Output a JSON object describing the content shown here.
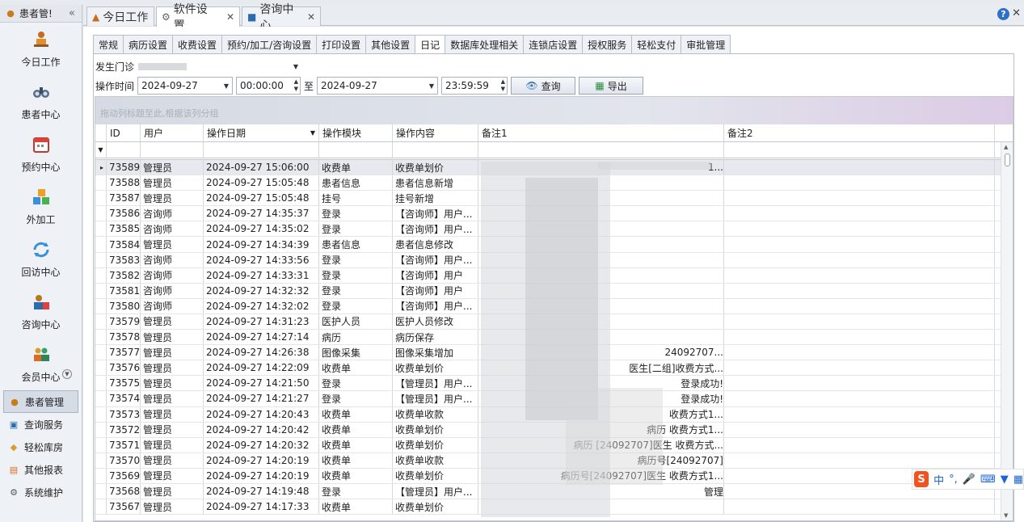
{
  "left_panel": {
    "title": "患者管!",
    "collapse_icon": "double-chevron-left-icon",
    "nav_items": [
      {
        "label": "今日工作",
        "icon": "person-at-desk-icon"
      },
      {
        "label": "患者中心",
        "icon": "binoculars-icon"
      },
      {
        "label": "预约中心",
        "icon": "calendar-icon"
      },
      {
        "label": "外加工",
        "icon": "cubes-icon"
      },
      {
        "label": "回访中心",
        "icon": "refresh-icon"
      },
      {
        "label": "咨询中心",
        "icon": "consultant-icon"
      },
      {
        "label": "会员中心",
        "icon": "members-icon"
      }
    ],
    "groups": [
      {
        "label": "患者管理",
        "active": true
      },
      {
        "label": "查询服务",
        "active": false
      },
      {
        "label": "轻松库房",
        "active": false
      },
      {
        "label": "其他报表",
        "active": false
      },
      {
        "label": "系统维护",
        "active": false
      }
    ]
  },
  "doc_tabs": [
    {
      "label": "今日工作",
      "closable": false,
      "active": false
    },
    {
      "label": "软件设置",
      "closable": true,
      "active": true
    },
    {
      "label": "咨询中心",
      "closable": true,
      "active": false
    }
  ],
  "sub_tabs": [
    {
      "label": "常规",
      "active": false
    },
    {
      "label": "病历设置",
      "active": false
    },
    {
      "label": "收费设置",
      "active": false
    },
    {
      "label": "预约/加工/咨询设置",
      "active": false
    },
    {
      "label": "打印设置",
      "active": false
    },
    {
      "label": "其他设置",
      "active": false
    },
    {
      "label": "日记",
      "active": true
    },
    {
      "label": "数据库处理相关",
      "active": false
    },
    {
      "label": "连锁店设置",
      "active": false
    },
    {
      "label": "授权服务",
      "active": false
    },
    {
      "label": "轻松支付",
      "active": false
    },
    {
      "label": "审批管理",
      "active": false
    }
  ],
  "filters": {
    "clinic_label": "发生门诊",
    "time_label": "操作时间",
    "start_date": "2024-09-27",
    "start_time": "00:00:00",
    "to_label": "至",
    "end_date": "2024-09-27",
    "end_time": "23:59:59",
    "query_button": "查询",
    "export_button": "导出"
  },
  "grid": {
    "group_hint": "拖动列标题至此,根据该列分组",
    "columns": [
      "ID",
      "用户",
      "操作日期",
      "操作模块",
      "操作内容",
      "备注1",
      "备注2"
    ],
    "rows": [
      {
        "id": "73589",
        "user": "管理员",
        "date": "2024-09-27 15:06:00",
        "module": "收费单",
        "content": "收费单划价",
        "note1": "1...",
        "note2": ""
      },
      {
        "id": "73588",
        "user": "管理员",
        "date": "2024-09-27 15:05:48",
        "module": "患者信息",
        "content": "患者信息新增",
        "note1": "",
        "note2": ""
      },
      {
        "id": "73587",
        "user": "管理员",
        "date": "2024-09-27 15:05:48",
        "module": "挂号",
        "content": "挂号新增",
        "note1": "",
        "note2": ""
      },
      {
        "id": "73586",
        "user": "咨询师",
        "date": "2024-09-27 14:35:37",
        "module": "登录",
        "content": "【咨询师】用户...",
        "note1": "",
        "note2": ""
      },
      {
        "id": "73585",
        "user": "咨询师",
        "date": "2024-09-27 14:35:02",
        "module": "登录",
        "content": "【咨询师】用户...",
        "note1": "",
        "note2": ""
      },
      {
        "id": "73584",
        "user": "管理员",
        "date": "2024-09-27 14:34:39",
        "module": "患者信息",
        "content": "患者信息修改",
        "note1": "",
        "note2": ""
      },
      {
        "id": "73583",
        "user": "咨询师",
        "date": "2024-09-27 14:33:56",
        "module": "登录",
        "content": "【咨询师】用户...",
        "note1": "",
        "note2": ""
      },
      {
        "id": "73582",
        "user": "咨询师",
        "date": "2024-09-27 14:33:31",
        "module": "登录",
        "content": "【咨询师】用户",
        "note1": "",
        "note2": ""
      },
      {
        "id": "73581",
        "user": "咨询师",
        "date": "2024-09-27 14:32:32",
        "module": "登录",
        "content": "【咨询师】用户",
        "note1": "",
        "note2": ""
      },
      {
        "id": "73580",
        "user": "咨询师",
        "date": "2024-09-27 14:32:02",
        "module": "登录",
        "content": "【咨询师】用户...",
        "note1": "",
        "note2": ""
      },
      {
        "id": "73579",
        "user": "管理员",
        "date": "2024-09-27 14:31:23",
        "module": "医护人员",
        "content": "医护人员修改",
        "note1": "",
        "note2": ""
      },
      {
        "id": "73578",
        "user": "管理员",
        "date": "2024-09-27 14:27:14",
        "module": "病历",
        "content": "病历保存",
        "note1": "",
        "note2": ""
      },
      {
        "id": "73577",
        "user": "管理员",
        "date": "2024-09-27 14:26:38",
        "module": "图像采集",
        "content": "图像采集增加",
        "note1": "24092707...",
        "note2": ""
      },
      {
        "id": "73576",
        "user": "管理员",
        "date": "2024-09-27 14:22:09",
        "module": "收费单",
        "content": "收费单划价",
        "note1": "医生[二组]收费方式...",
        "note2": ""
      },
      {
        "id": "73575",
        "user": "管理员",
        "date": "2024-09-27 14:21:50",
        "module": "登录",
        "content": "【管理员】用户...",
        "note1": "登录成功!",
        "note2": ""
      },
      {
        "id": "73574",
        "user": "管理员",
        "date": "2024-09-27 14:21:27",
        "module": "登录",
        "content": "【管理员】用户...",
        "note1": "登录成功!",
        "note2": ""
      },
      {
        "id": "73573",
        "user": "管理员",
        "date": "2024-09-27 14:20:43",
        "module": "收费单",
        "content": "收费单收款",
        "note1": "收费方式1...",
        "note2": ""
      },
      {
        "id": "73572",
        "user": "管理员",
        "date": "2024-09-27 14:20:42",
        "module": "收费单",
        "content": "收费单划价",
        "note1": "病历 收费方式1...",
        "note2": ""
      },
      {
        "id": "73571",
        "user": "管理员",
        "date": "2024-09-27 14:20:32",
        "module": "收费单",
        "content": "收费单划价",
        "note1": "病历 [24092707]医生 收费方式...",
        "note2": ""
      },
      {
        "id": "73570",
        "user": "管理员",
        "date": "2024-09-27 14:20:19",
        "module": "收费单",
        "content": "收费单收款",
        "note1": "病历号[24092707]",
        "note2": ""
      },
      {
        "id": "73569",
        "user": "管理员",
        "date": "2024-09-27 14:20:19",
        "module": "收费单",
        "content": "收费单划价",
        "note1": "病历号[24092707]医生 收费方式1...",
        "note2": ""
      },
      {
        "id": "73568",
        "user": "管理员",
        "date": "2024-09-27 14:19:48",
        "module": "登录",
        "content": "【管理员】用户...",
        "note1": "管理",
        "note2": ""
      },
      {
        "id": "73567",
        "user": "管理员",
        "date": "2024-09-27 14:17:33",
        "module": "收费单",
        "content": "收费单划价",
        "note1": "",
        "note2": ""
      }
    ]
  },
  "ime": {
    "logo": "S",
    "mode": "中",
    "punct": "°,",
    "icons": [
      "microphone-icon",
      "keyboard-icon",
      "shirt-icon",
      "grid-icon"
    ]
  }
}
